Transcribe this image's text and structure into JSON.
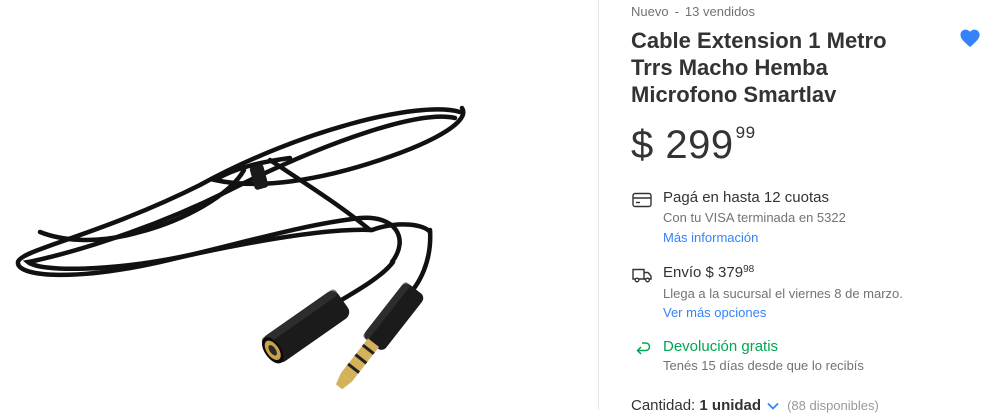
{
  "product": {
    "condition": "Nuevo",
    "separator": "|",
    "sold": "13 vendidos",
    "title": "Cable Extension 1 Metro Trrs Macho Hemba Microfono Smartlav",
    "favorite_icon": "heart-icon",
    "price": {
      "currency": "$",
      "amount": "299",
      "cents": "99"
    }
  },
  "installments": {
    "icon": "credit-card-icon",
    "title": "Pagá en hasta 12 cuotas",
    "detail": "Con tu VISA terminada en 5322",
    "link": "Más información"
  },
  "shipping": {
    "icon": "truck-icon",
    "label": "Envío",
    "currency": "$",
    "amount": "379",
    "cents": "98",
    "detail": "Llega a la sucursal el viernes 8 de marzo.",
    "link": "Ver más opciones"
  },
  "returns": {
    "icon": "return-arrow-icon",
    "title": "Devolución gratis",
    "detail": "Tenés 15 días desde que lo recibís"
  },
  "quantity": {
    "label": "Cantidad:",
    "value": "1 unidad",
    "available": "(88 disponibles)"
  },
  "colors": {
    "link": "#3483fa",
    "green": "#00a650",
    "heart": "#3483fa"
  }
}
